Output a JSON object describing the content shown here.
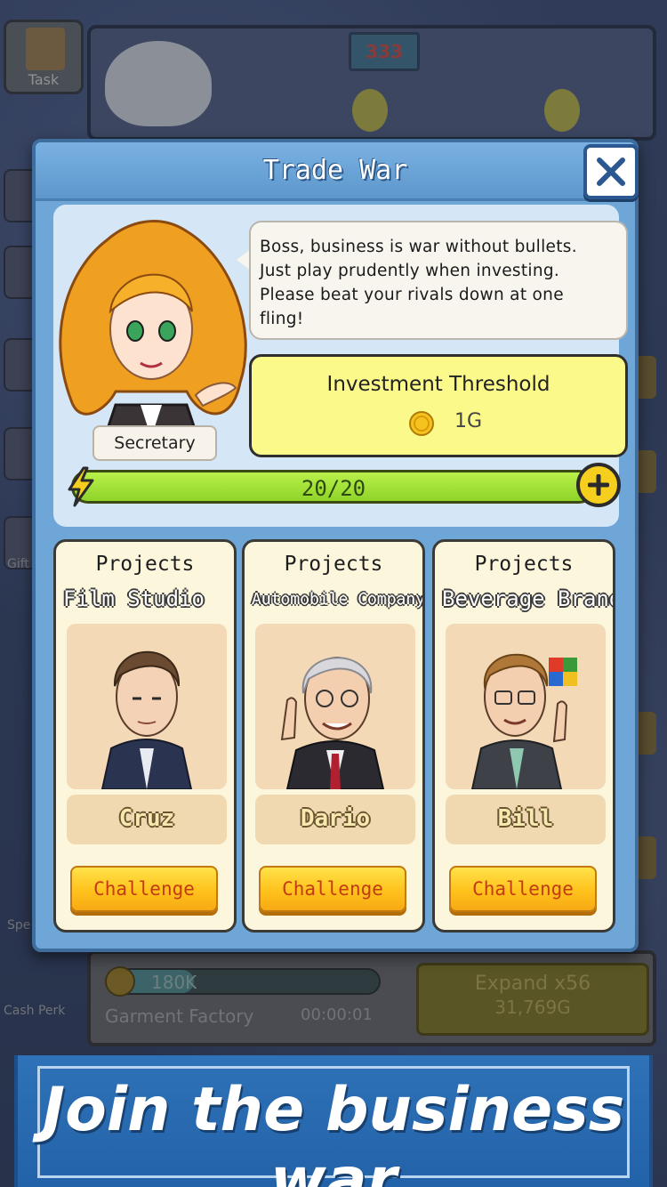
{
  "background": {
    "task_label": "Task",
    "sign_text": "333",
    "left_labels": [
      "Gift",
      "Spe"
    ],
    "progress": {
      "text": "180K",
      "fill_fraction": 0.32
    },
    "factory_name": "Garment Factory",
    "timer": "00:00:01",
    "expand": {
      "label": "Expand x56",
      "cost": "31,769G"
    },
    "cash_perk_label": "Cash Perk"
  },
  "dialog": {
    "title": "Trade War",
    "secretary": {
      "label": "Secretary",
      "speech": [
        "Boss, business is war without bullets.",
        "Just play prudently when investing.",
        "Please beat your rivals down at one",
        "fling!"
      ]
    },
    "threshold": {
      "title": "Investment Threshold",
      "value": "1G"
    },
    "energy": {
      "text": "20/20",
      "current": 20,
      "max": 20
    },
    "cards": [
      {
        "heading": "Projects",
        "project": "Film Studio",
        "rival": "Cruz",
        "button": "Challenge"
      },
      {
        "heading": "Projects",
        "project": "Automobile Company",
        "rival": "Dario",
        "button": "Challenge"
      },
      {
        "heading": "Projects",
        "project": "Beverage Brand",
        "rival": "Bill",
        "button": "Challenge"
      }
    ]
  },
  "banner": {
    "text": "Join the business war"
  },
  "colors": {
    "dialog_blue": "#6fa6d8",
    "panel_light": "#d5e7f7",
    "threshold_yellow": "#fbf98a",
    "energy_green": "#9ee236",
    "challenge_orange": "#ffc21c",
    "banner_blue": "#2a6ab0"
  },
  "icons": [
    "close-icon",
    "coin-icon",
    "lightning-icon",
    "plus-icon"
  ]
}
